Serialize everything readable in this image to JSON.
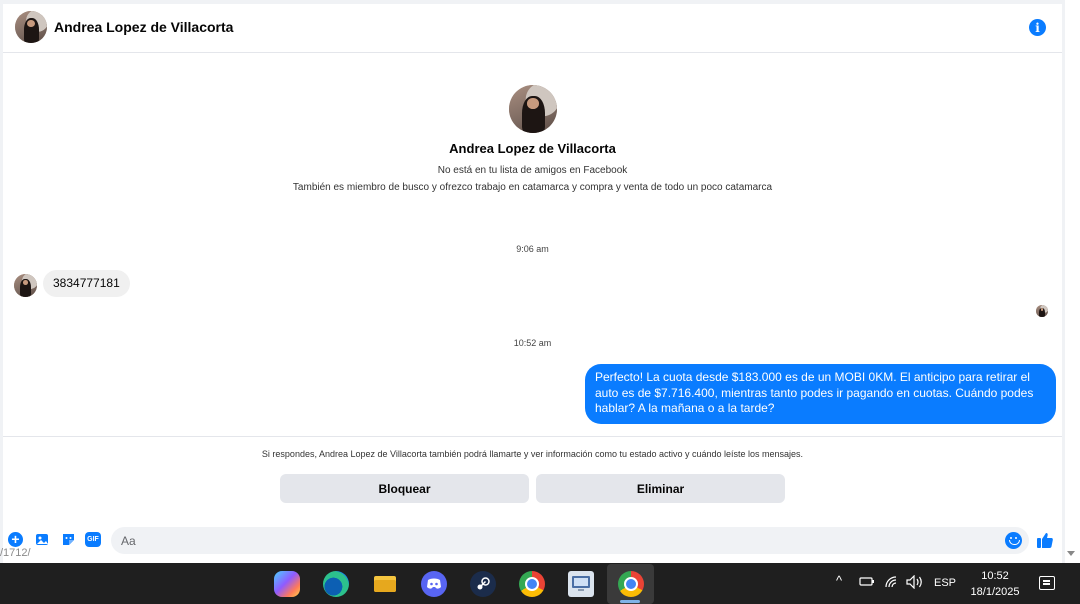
{
  "header": {
    "contact_name": "Andrea Lopez de Villacorta",
    "info_icon": "info-icon"
  },
  "intro": {
    "name": "Andrea Lopez de Villacorta",
    "line1": "No está en tu lista de amigos en Facebook",
    "line2": "También es miembro de busco y ofrezco trabajo en catamarca y compra y venta de todo un poco catamarca"
  },
  "messages": [
    {
      "time": "9:06 am",
      "direction": "incoming",
      "text": "3834777181"
    },
    {
      "time": "10:52 am",
      "direction": "outgoing",
      "text": "Perfecto! La cuota desde $183.000 es de un MOBI 0KM. El anticipo para retirar el auto es de $7.716.400, mientras tanto podes ir pagando en cuotas. Cuándo podes hablar? A la mañana o a la tarde?"
    }
  ],
  "request": {
    "notice": "Si respondes, Andrea Lopez de Villacorta también podrá llamarte y ver información como tu estado activo y cuándo leíste los mensajes.",
    "block_label": "Bloquear",
    "delete_label": "Eliminar"
  },
  "composer": {
    "placeholder": "Aa",
    "gif_label": "GIF"
  },
  "url_fragment": "/1712/",
  "colors": {
    "accent": "#0a7cff",
    "outgoing_bubble": "#0a7cff",
    "incoming_bubble": "#f0f0f0",
    "taskbar": "#1f1f1f"
  },
  "taskbar": {
    "apps": [
      "copilot-icon",
      "edge-icon",
      "file-explorer-icon",
      "discord-icon",
      "steam-icon",
      "chrome-icon",
      "remote-desktop-icon",
      "chrome-profile-icon"
    ],
    "language": "ESP",
    "time": "10:52",
    "date": "18/1/2025"
  }
}
